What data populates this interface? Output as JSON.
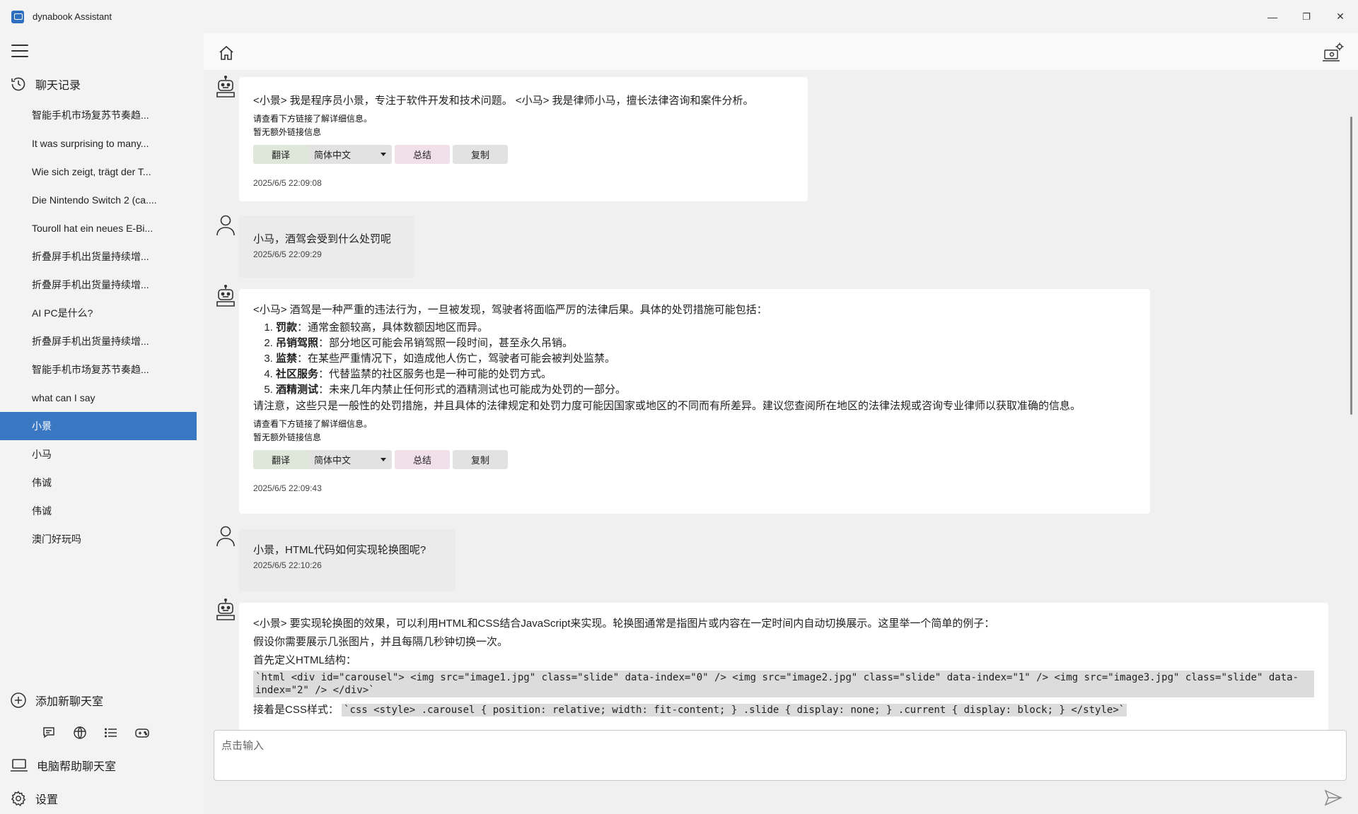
{
  "window": {
    "title": "dynabook Assistant",
    "minimize": "—",
    "maximize": "❐",
    "close": "✕"
  },
  "sidebar": {
    "history_title": "聊天记录",
    "items": [
      {
        "label": "智能手机市场复苏节奏趋..."
      },
      {
        "label": "It was surprising to many..."
      },
      {
        "label": "Wie sich zeigt, trägt der T..."
      },
      {
        "label": "Die Nintendo Switch 2 (ca...."
      },
      {
        "label": "Touroll hat ein neues E-Bi..."
      },
      {
        "label": "折叠屏手机出货量持续增..."
      },
      {
        "label": "折叠屏手机出货量持续增..."
      },
      {
        "label": "AI PC是什么?"
      },
      {
        "label": "折叠屏手机出货量持续增..."
      },
      {
        "label": "智能手机市场复苏节奏趋..."
      },
      {
        "label": "what can I say"
      },
      {
        "label": "小景",
        "active": true
      },
      {
        "label": "小马"
      },
      {
        "label": "伟诚"
      },
      {
        "label": "伟诚"
      },
      {
        "label": "澳门好玩吗"
      }
    ],
    "add_chat": "添加新聊天室",
    "pc_help": "电脑帮助聊天室",
    "settings": "设置"
  },
  "actions": {
    "translate": "翻译",
    "language": "简体中文",
    "summary": "总结",
    "copy": "复制"
  },
  "messages": {
    "m1": {
      "text": "<小景> 我是程序员小景，专注于软件开发和技术问题。 <小马> 我是律师小马，擅长法律咨询和案件分析。",
      "link_hint": "请查看下方链接了解详细信息。",
      "no_link": "暂无额外链接信息",
      "time": "2025/6/5 22:09:08"
    },
    "m2": {
      "text": "小马，酒驾会受到什么处罚呢",
      "time": "2025/6/5 22:09:29"
    },
    "m3": {
      "intro": "<小马> 酒驾是一种严重的违法行为，一旦被发现，驾驶者将面临严厉的法律后果。具体的处罚措施可能包括：",
      "list": [
        {
          "term": "罚款",
          "desc": "：通常金额较高，具体数额因地区而异。"
        },
        {
          "term": "吊销驾照",
          "desc": "：部分地区可能会吊销驾照一段时间，甚至永久吊销。"
        },
        {
          "term": "监禁",
          "desc": "：在某些严重情况下，如造成他人伤亡，驾驶者可能会被判处监禁。"
        },
        {
          "term": "社区服务",
          "desc": "：代替监禁的社区服务也是一种可能的处罚方式。"
        },
        {
          "term": "酒精测试",
          "desc": "：未来几年内禁止任何形式的酒精测试也可能成为处罚的一部分。"
        }
      ],
      "note": "请注意，这些只是一般性的处罚措施，并且具体的法律规定和处罚力度可能因国家或地区的不同而有所差异。建议您查阅所在地区的法律法规或咨询专业律师以获取准确的信息。",
      "link_hint": "请查看下方链接了解详细信息。",
      "no_link": "暂无额外链接信息",
      "time": "2025/6/5 22:09:43"
    },
    "m4": {
      "text": "小景，HTML代码如何实现轮换图呢?",
      "time": "2025/6/5 22:10:26"
    },
    "m5": {
      "intro": "<小景> 要实现轮换图的效果，可以利用HTML和CSS结合JavaScript来实现。轮换图通常是指图片或内容在一定时间内自动切换展示。这里举一个简单的例子：",
      "line2": "假设你需要展示几张图片，并且每隔几秒钟切换一次。",
      "line3": "首先定义HTML结构：",
      "code1": "`html <div id=\"carousel\"> <img src=\"image1.jpg\" class=\"slide\" data-index=\"0\" /> <img src=\"image2.jpg\" class=\"slide\" data-index=\"1\" /> <img src=\"image3.jpg\" class=\"slide\" data-index=\"2\" /> </div>`",
      "line4": "接着是CSS样式：",
      "code2": "`css <style> .carousel { position: relative; width: fit-content; } .slide { display: none; } .current { display: block; } </style>`"
    }
  },
  "input": {
    "placeholder": "点击输入"
  }
}
